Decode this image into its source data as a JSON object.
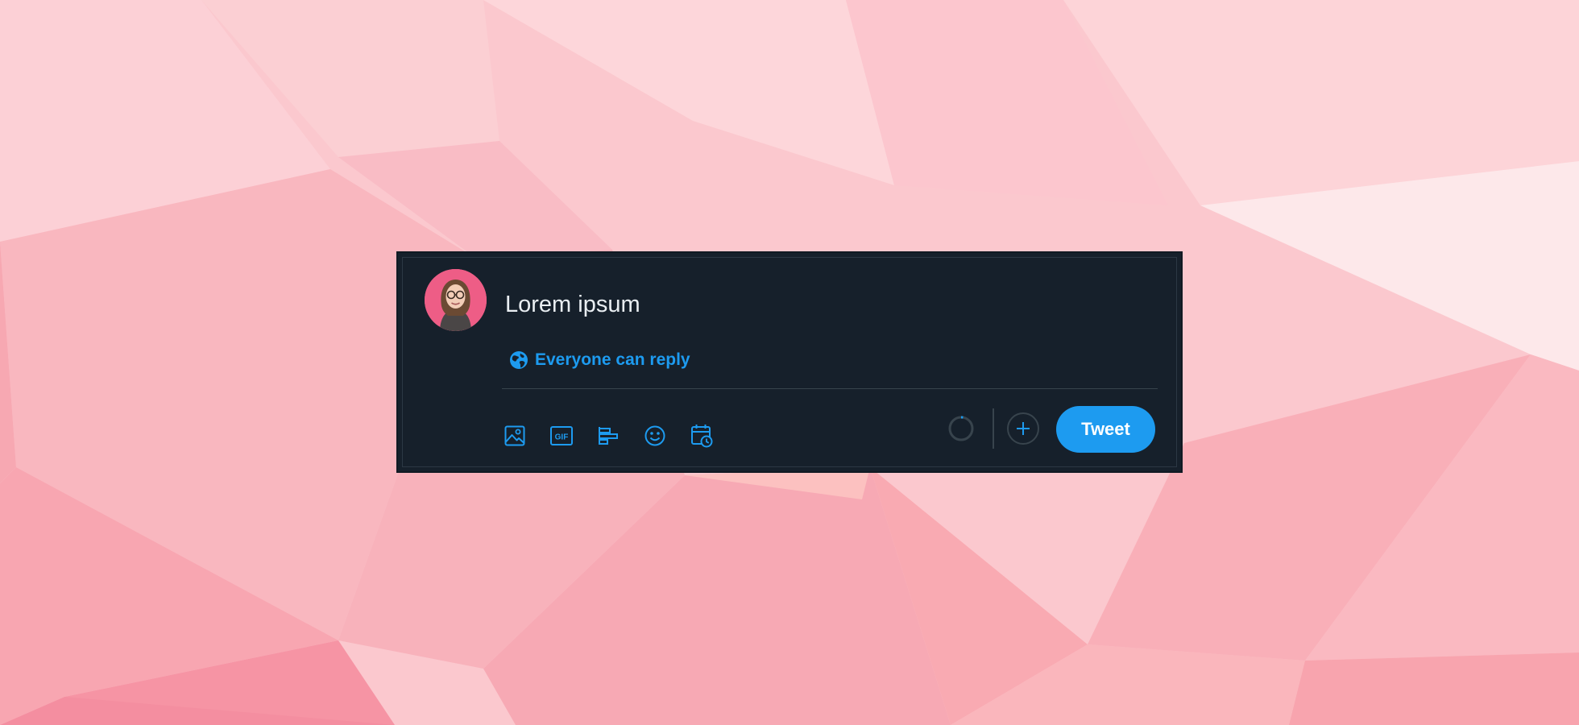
{
  "composer": {
    "text": "Lorem ipsum",
    "reply_setting": "Everyone can reply",
    "tweet_label": "Tweet"
  },
  "toolbar": {
    "icons": [
      "image-icon",
      "gif-icon",
      "poll-icon",
      "emoji-icon",
      "schedule-icon"
    ]
  },
  "colors": {
    "panel": "#16202b",
    "accent": "#1d9bf0",
    "divider": "#38444d",
    "text": "#e9eef2"
  }
}
